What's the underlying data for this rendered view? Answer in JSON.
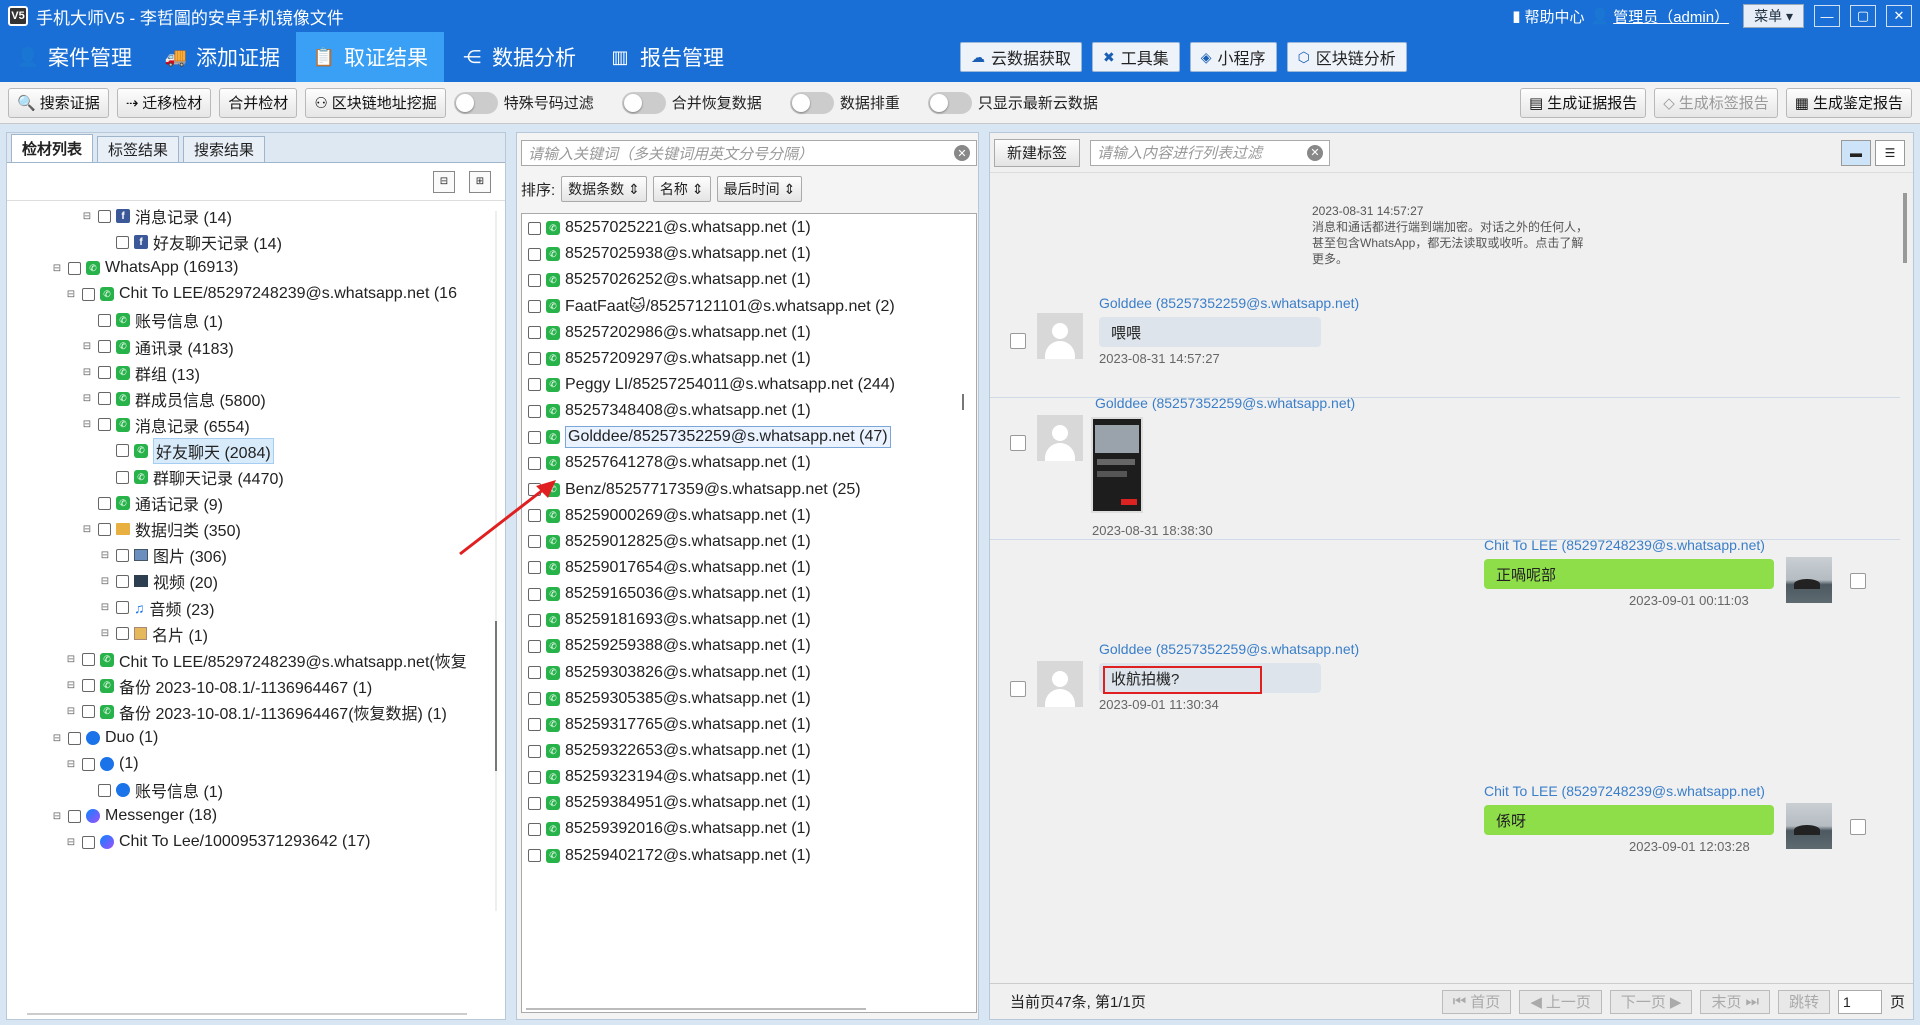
{
  "titlebar": {
    "title": "手机大师V5 - 李哲圖的安卓手机镜像文件",
    "help": "帮助中心",
    "admin": "管理员（admin）",
    "menu": "菜单"
  },
  "nav": {
    "items": [
      "案件管理",
      "添加证据",
      "取证结果",
      "数据分析",
      "报告管理"
    ],
    "active": "取证结果",
    "tools": [
      "云数据获取",
      "工具集",
      "小程序",
      "区块链分析"
    ]
  },
  "toolbar": {
    "buttons": [
      "搜索证据",
      "迁移检材",
      "合并检材",
      "区块链地址挖掘"
    ],
    "toggles": [
      "特殊号码过滤",
      "合并恢复数据",
      "数据排重",
      "只显示最新云数据"
    ],
    "report_buttons": [
      "生成证据报告",
      "生成标签报告",
      "生成鉴定报告"
    ]
  },
  "left": {
    "tabs": [
      "检材列表",
      "标签结果",
      "搜索结果"
    ],
    "tree": [
      {
        "label": "消息记录 (14)",
        "icon": "facebook"
      },
      {
        "label": "好友聊天记录 (14)",
        "icon": "facebook"
      },
      {
        "label": "WhatsApp (16913)",
        "icon": "whatsapp"
      },
      {
        "label": "Chit To LEE/85297248239@s.whatsapp.net (16",
        "icon": "whatsapp"
      },
      {
        "label": "账号信息 (1)",
        "icon": "whatsapp"
      },
      {
        "label": "通讯录 (4183)",
        "icon": "whatsapp"
      },
      {
        "label": "群组 (13)",
        "icon": "whatsapp"
      },
      {
        "label": "群成员信息 (5800)",
        "icon": "whatsapp"
      },
      {
        "label": "消息记录 (6554)",
        "icon": "whatsapp"
      },
      {
        "label": "好友聊天 (2084)",
        "icon": "whatsapp"
      },
      {
        "label": "群聊天记录 (4470)",
        "icon": "whatsapp"
      },
      {
        "label": "通话记录 (9)",
        "icon": "whatsapp"
      },
      {
        "label": "数据归类 (350)",
        "icon": "folder"
      },
      {
        "label": "图片 (306)",
        "icon": "image"
      },
      {
        "label": "视频 (20)",
        "icon": "video"
      },
      {
        "label": "音频 (23)",
        "icon": "audio"
      },
      {
        "label": "名片 (1)",
        "icon": "card"
      },
      {
        "label": "Chit To LEE/85297248239@s.whatsapp.net(恢复",
        "icon": "whatsapp"
      },
      {
        "label": "备份 2023-10-08.1/-1136964467 (1)",
        "icon": "whatsapp"
      },
      {
        "label": "备份 2023-10-08.1/-1136964467(恢复数据) (1)",
        "icon": "whatsapp"
      },
      {
        "label": "Duo (1)",
        "icon": "duo"
      },
      {
        "label": " (1)",
        "icon": "duo"
      },
      {
        "label": "账号信息 (1)",
        "icon": "duo"
      },
      {
        "label": "Messenger (18)",
        "icon": "messenger"
      },
      {
        "label": "Chit To Lee/100095371293642 (17)",
        "icon": "messenger"
      }
    ]
  },
  "middle": {
    "search_placeholder": "请输入关键词（多关键词用英文分号分隔）",
    "sort_label": "排序:",
    "sort_buttons": [
      "数据条数",
      "名称",
      "最后时间"
    ],
    "contacts": [
      "85257025221@s.whatsapp.net (1)",
      "85257025938@s.whatsapp.net (1)",
      "85257026252@s.whatsapp.net (1)",
      "FaatFaat🐱/85257121101@s.whatsapp.net (2)",
      "85257202986@s.whatsapp.net (1)",
      "85257209297@s.whatsapp.net (1)",
      "Peggy LI/85257254011@s.whatsapp.net (244)",
      "85257348408@s.whatsapp.net (1)",
      "Golddee/85257352259@s.whatsapp.net (47)",
      "85257641278@s.whatsapp.net (1)",
      "Benz/85257717359@s.whatsapp.net (25)",
      "85259000269@s.whatsapp.net (1)",
      "85259012825@s.whatsapp.net (1)",
      "85259017654@s.whatsapp.net (1)",
      "85259165036@s.whatsapp.net (1)",
      "85259181693@s.whatsapp.net (1)",
      "85259259388@s.whatsapp.net (1)",
      "85259303826@s.whatsapp.net (1)",
      "85259305385@s.whatsapp.net (1)",
      "85259317765@s.whatsapp.net (1)",
      "85259322653@s.whatsapp.net (1)",
      "85259323194@s.whatsapp.net (1)",
      "85259384951@s.whatsapp.net (1)",
      "85259392016@s.whatsapp.net (1)",
      "85259402172@s.whatsapp.net (1)"
    ],
    "selected_index": 8
  },
  "right": {
    "new_tag": "新建标签",
    "filter_placeholder": "请输入内容进行列表过滤",
    "system_message": {
      "time": "2023-08-31 14:57:27",
      "text": "消息和通话都进行端到端加密。对话之外的任何人，甚至包含WhatsApp，都无法读取或收听。点击了解更多。"
    },
    "messages": [
      {
        "sender": "Golddee (85257352259@s.whatsapp.net)",
        "text": "喂喂",
        "time": "2023-08-31 14:57:27"
      },
      {
        "sender": "Golddee (85257352259@s.whatsapp.net)",
        "text": "",
        "time": "2023-08-31 18:38:30"
      },
      {
        "sender": "Chit To LEE (85297248239@s.whatsapp.net)",
        "text": "正喎呢部",
        "time": "2023-09-01 00:11:03"
      },
      {
        "sender": "Golddee (85257352259@s.whatsapp.net)",
        "text": "收航拍機?",
        "time": "2023-09-01 11:30:34"
      },
      {
        "sender": "Chit To LEE (85297248239@s.whatsapp.net)",
        "text": "係呀",
        "time": "2023-09-01 12:03:28"
      }
    ],
    "pager": {
      "summary": "当前页47条,    第1/1页",
      "buttons": [
        "首页",
        "上一页",
        "下一页",
        "末页"
      ],
      "jump": "跳转",
      "page_input": "1",
      "page_suffix": "页"
    }
  },
  "colors": {
    "titlebar": "#1a6fd6",
    "active_nav": "#3aa0f5",
    "outgoing_bubble": "#8ede4a",
    "annotation": "#e02020"
  }
}
